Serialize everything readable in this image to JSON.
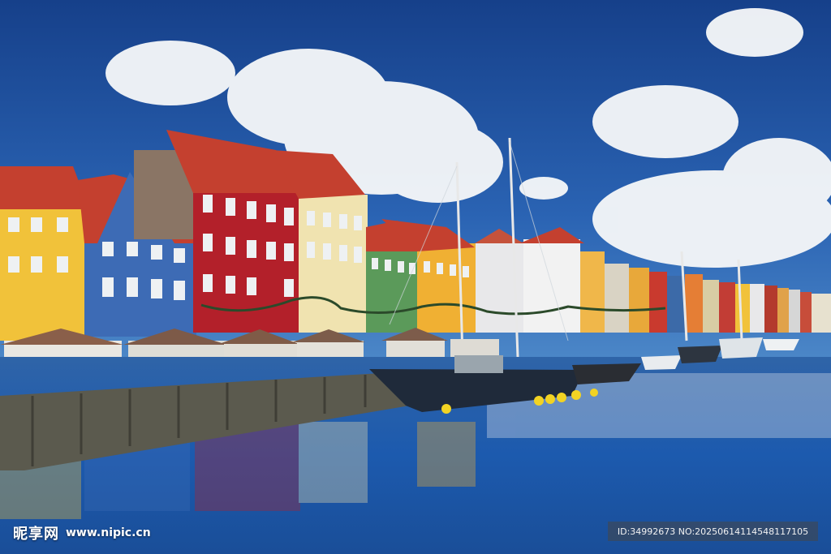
{
  "watermark": {
    "logo_text": "昵享网",
    "url": "www.nipic.cn",
    "id_line": "ID:34992673 NO:20250614114548117105"
  },
  "scene": {
    "subject": "canal-harbour-with-colorful-townhouses",
    "colors": {
      "sky": "#1d4f9e",
      "cloud": "#f4f6f8",
      "water": "#1d5fb0",
      "quay": "#5b5a4e",
      "red_house": "#b3202a",
      "blue_house": "#3d6bb5",
      "yellow_house": "#f1c23a",
      "cream_house": "#f0e3b0",
      "green_house": "#5b9a5a",
      "roof": "#c4402f"
    }
  }
}
